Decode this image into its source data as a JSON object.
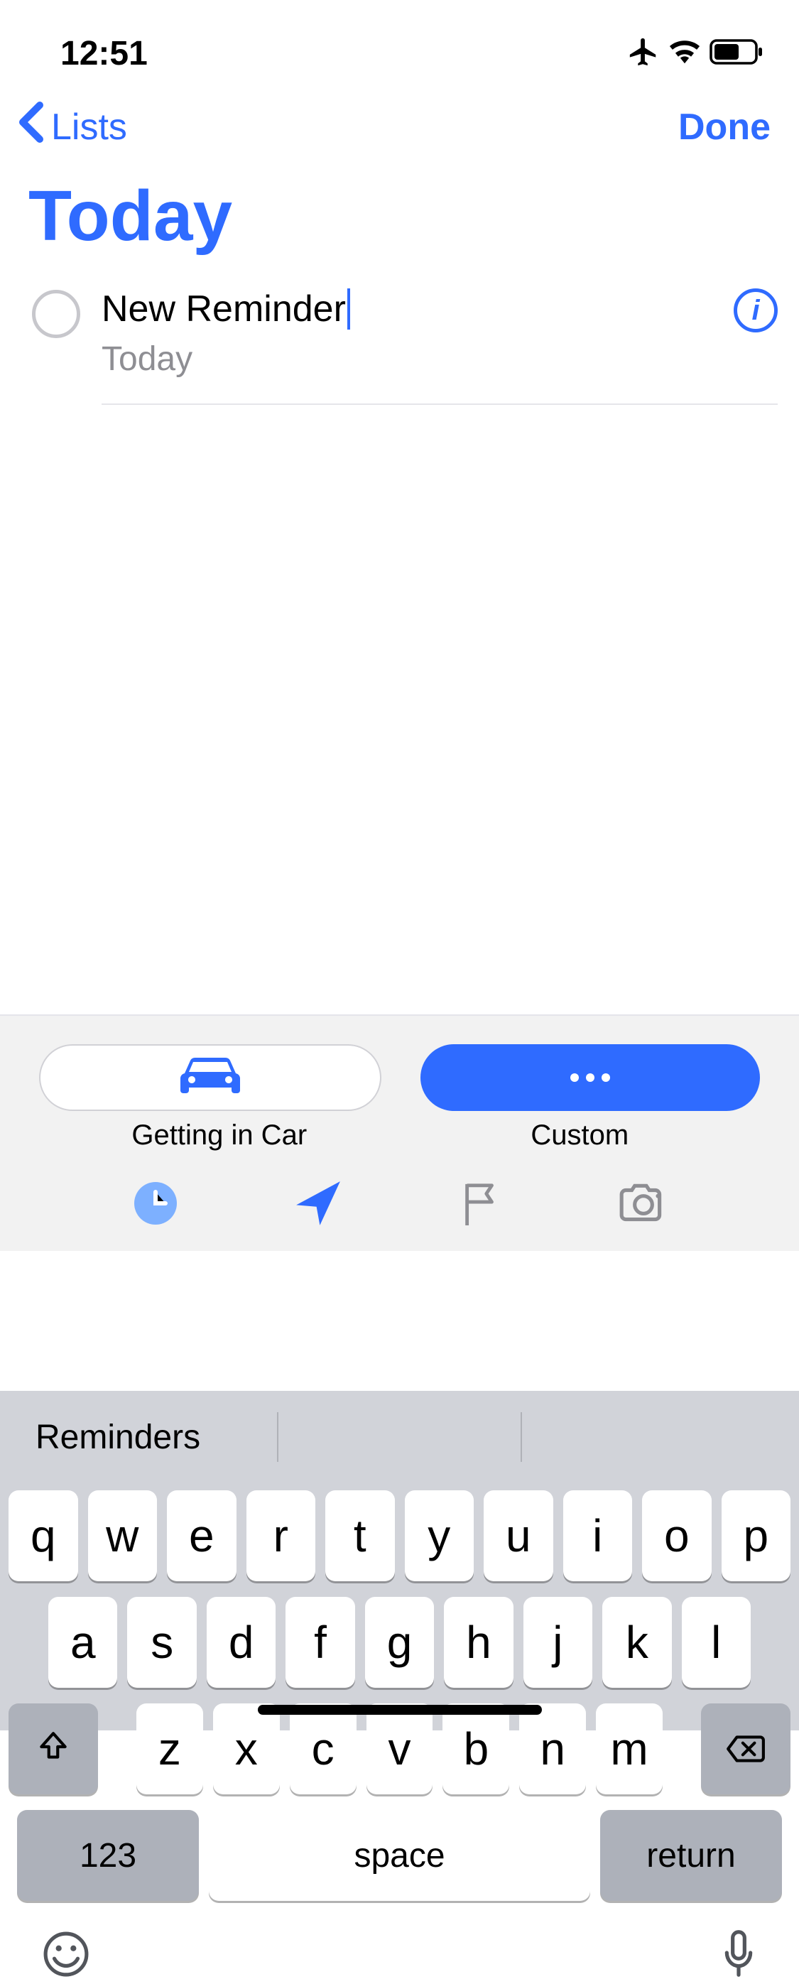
{
  "statusBar": {
    "time": "12:51"
  },
  "nav": {
    "back": "Lists",
    "done": "Done"
  },
  "title": "Today",
  "reminder": {
    "title": "New Reminder",
    "subtitle": "Today"
  },
  "suggestions": {
    "chip1": {
      "label": "Getting in Car"
    },
    "chip2": {
      "label": "Custom"
    }
  },
  "keyboard": {
    "prediction": "Reminders",
    "row1": [
      "q",
      "w",
      "e",
      "r",
      "t",
      "y",
      "u",
      "i",
      "o",
      "p"
    ],
    "row2": [
      "a",
      "s",
      "d",
      "f",
      "g",
      "h",
      "j",
      "k",
      "l"
    ],
    "row3": [
      "z",
      "x",
      "c",
      "v",
      "b",
      "n",
      "m"
    ],
    "numKey": "123",
    "spaceKey": "space",
    "returnKey": "return"
  }
}
